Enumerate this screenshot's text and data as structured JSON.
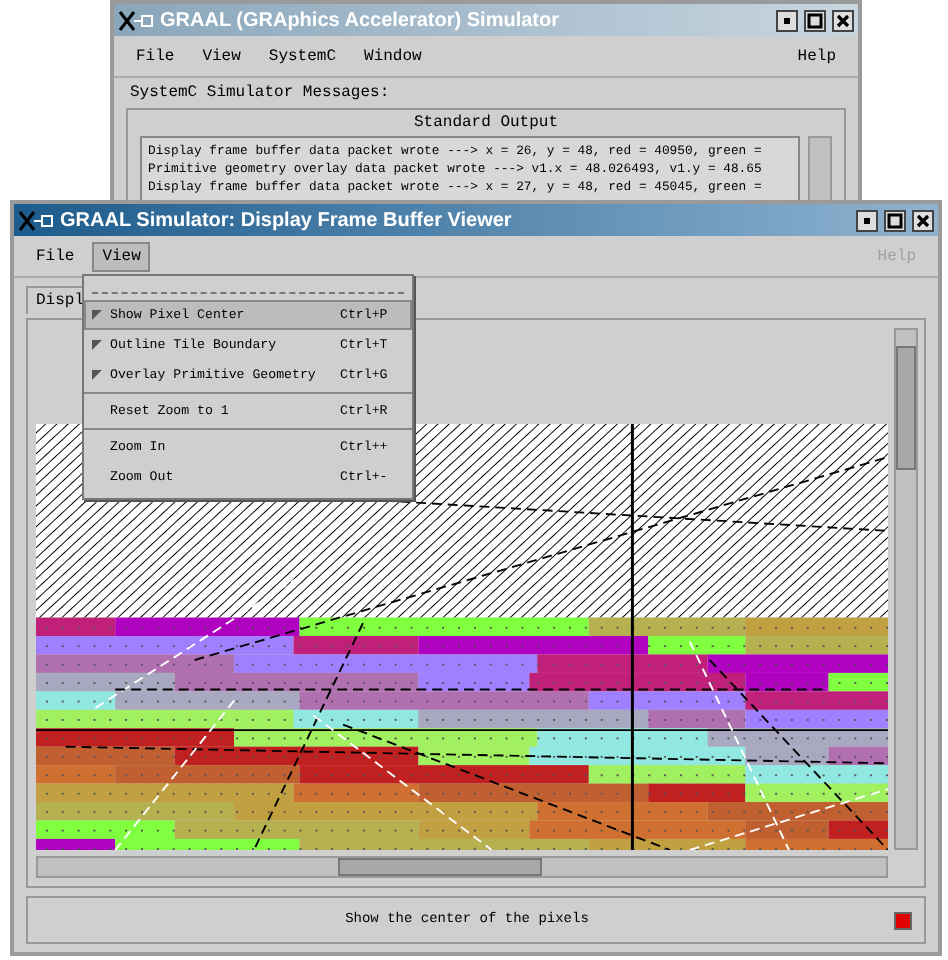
{
  "back_window": {
    "title": "GRAAL (GRAphics Accelerator) Simulator",
    "menus": [
      {
        "label": "File"
      },
      {
        "label": "View"
      },
      {
        "label": "SystemC"
      },
      {
        "label": "Window"
      }
    ],
    "help_menu": "Help",
    "section_label": "SystemC Simulator Messages:",
    "output": {
      "title": "Standard Output",
      "lines": [
        "Display frame buffer data packet wrote ---> x = 26, y = 48, red = 40950, green =",
        "Primitive geometry overlay data packet wrote ---> v1.x = 48.026493, v1.y = 48.65",
        "Display frame buffer data packet wrote ---> x = 27, y = 48, red = 45045, green ="
      ]
    }
  },
  "front_window": {
    "title": "GRAAL Simulator: Display Frame Buffer Viewer",
    "menus": [
      {
        "label": "File",
        "selected": false
      },
      {
        "label": "View",
        "selected": true
      }
    ],
    "help_menu": {
      "label": "Help",
      "disabled": true
    },
    "tab": {
      "label": "Displ"
    },
    "status": "Show the center of the pixels"
  },
  "view_menu": {
    "groups": [
      [
        {
          "kind": "check",
          "label": "Show Pixel Center",
          "shortcut": "Ctrl+P",
          "checked": true,
          "selected": true
        },
        {
          "kind": "check",
          "label": "Outline Tile Boundary",
          "shortcut": "Ctrl+T",
          "checked": true,
          "selected": false
        },
        {
          "kind": "check",
          "label": "Overlay Primitive Geometry",
          "shortcut": "Ctrl+G",
          "checked": true,
          "selected": false
        }
      ],
      [
        {
          "kind": "command",
          "label": "Reset Zoom to 1",
          "shortcut": "Ctrl+R",
          "selected": false
        }
      ],
      [
        {
          "kind": "command",
          "label": "Zoom In",
          "shortcut": "Ctrl++",
          "selected": false
        },
        {
          "kind": "command",
          "label": "Zoom Out",
          "shortcut": "Ctrl+-",
          "selected": false
        }
      ]
    ]
  }
}
